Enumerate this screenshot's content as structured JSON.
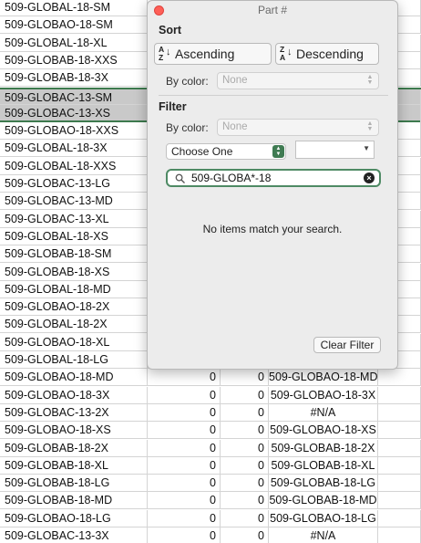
{
  "sheet": {
    "rows": [
      {
        "a": "509-GLOBAL-18-SM",
        "b": "",
        "c": "",
        "d": ""
      },
      {
        "a": "509-GLOBAO-18-SM",
        "b": "",
        "c": "",
        "d": ""
      },
      {
        "a": "509-GLOBAL-18-XL",
        "b": "",
        "c": "",
        "d": ""
      },
      {
        "a": "509-GLOBAB-18-XXS",
        "b": "",
        "c": "",
        "d": ""
      },
      {
        "a": "509-GLOBAB-18-3X",
        "b": "",
        "c": "",
        "d": ""
      },
      {
        "a": "509-GLOBAC-13-SM",
        "b": "",
        "c": "",
        "d": ""
      },
      {
        "a": "509-GLOBAC-13-XS",
        "b": "",
        "c": "",
        "d": ""
      },
      {
        "a": "509-GLOBAO-18-XXS",
        "b": "",
        "c": "",
        "d": ""
      },
      {
        "a": "509-GLOBAL-18-3X",
        "b": "",
        "c": "",
        "d": ""
      },
      {
        "a": "509-GLOBAL-18-XXS",
        "b": "",
        "c": "",
        "d": ""
      },
      {
        "a": "509-GLOBAC-13-LG",
        "b": "",
        "c": "",
        "d": ""
      },
      {
        "a": "509-GLOBAC-13-MD",
        "b": "",
        "c": "",
        "d": ""
      },
      {
        "a": "509-GLOBAC-13-XL",
        "b": "",
        "c": "",
        "d": ""
      },
      {
        "a": "509-GLOBAL-18-XS",
        "b": "",
        "c": "",
        "d": ""
      },
      {
        "a": "509-GLOBAB-18-SM",
        "b": "",
        "c": "",
        "d": ""
      },
      {
        "a": "509-GLOBAB-18-XS",
        "b": "",
        "c": "",
        "d": ""
      },
      {
        "a": "509-GLOBAL-18-MD",
        "b": "",
        "c": "",
        "d": ""
      },
      {
        "a": "509-GLOBAO-18-2X",
        "b": "",
        "c": "",
        "d": ""
      },
      {
        "a": "509-GLOBAL-18-2X",
        "b": "",
        "c": "",
        "d": ""
      },
      {
        "a": "509-GLOBAO-18-XL",
        "b": "",
        "c": "",
        "d": ""
      },
      {
        "a": "509-GLOBAL-18-LG",
        "b": "",
        "c": "",
        "d": ""
      },
      {
        "a": "509-GLOBAO-18-MD",
        "b": "0",
        "c": "0",
        "d": "509-GLOBAO-18-MD"
      },
      {
        "a": "509-GLOBAO-18-3X",
        "b": "0",
        "c": "0",
        "d": "509-GLOBAO-18-3X"
      },
      {
        "a": "509-GLOBAC-13-2X",
        "b": "0",
        "c": "0",
        "d": "#N/A"
      },
      {
        "a": "509-GLOBAO-18-XS",
        "b": "0",
        "c": "0",
        "d": "509-GLOBAO-18-XS"
      },
      {
        "a": "509-GLOBAB-18-2X",
        "b": "0",
        "c": "0",
        "d": "509-GLOBAB-18-2X"
      },
      {
        "a": "509-GLOBAB-18-XL",
        "b": "0",
        "c": "0",
        "d": "509-GLOBAB-18-XL"
      },
      {
        "a": "509-GLOBAB-18-LG",
        "b": "0",
        "c": "0",
        "d": "509-GLOBAB-18-LG"
      },
      {
        "a": "509-GLOBAB-18-MD",
        "b": "0",
        "c": "0",
        "d": "509-GLOBAB-18-MD"
      },
      {
        "a": "509-GLOBAO-18-LG",
        "b": "0",
        "c": "0",
        "d": "509-GLOBAO-18-LG"
      },
      {
        "a": "509-GLOBAC-13-3X",
        "b": "0",
        "c": "0",
        "d": "#N/A"
      }
    ]
  },
  "popover": {
    "title": "Part #",
    "sort": {
      "heading": "Sort",
      "ascending_label": "Ascending",
      "descending_label": "Descending",
      "by_color_label": "By color:",
      "by_color_value": "None"
    },
    "filter": {
      "heading": "Filter",
      "by_color_label": "By color:",
      "by_color_value": "None",
      "condition_value": "Choose One",
      "search_value": "509-GLOBA*-18",
      "no_items_message": "No items match your search.",
      "clear_filter_label": "Clear Filter"
    }
  },
  "icons": {
    "sort_ascending": "sort-a-to-z-icon",
    "sort_descending": "sort-z-to-a-icon",
    "search": "magnifier-icon",
    "clear": "clear-x-circle-icon",
    "close": "close-window-icon"
  },
  "colors": {
    "selection_border": "#3d7a4e",
    "search_focus": "#4e8a64",
    "close_button": "#fe5f57"
  }
}
